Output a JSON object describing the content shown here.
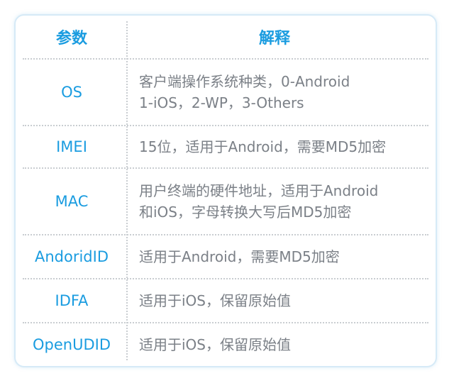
{
  "header": {
    "param": "参数",
    "desc": "解释"
  },
  "rows": [
    {
      "param": "OS",
      "desc": [
        "客户端操作系统种类，0-Android",
        "1-iOS，2-WP，3-Others"
      ]
    },
    {
      "param": "IMEI",
      "desc": [
        "15位，适用于Android，需要MD5加密"
      ]
    },
    {
      "param": "MAC",
      "desc": [
        "用户终端的硬件地址，适用于Android",
        "和iOS，字母转换大写后MD5加密"
      ]
    },
    {
      "param": "AndoridID",
      "desc": [
        "适用于Android，需要MD5加密"
      ]
    },
    {
      "param": "IDFA",
      "desc": [
        "适用于iOS，保留原始值"
      ]
    },
    {
      "param": "OpenUDID",
      "desc": [
        "适用于iOS，保留原始值"
      ]
    }
  ],
  "colors": {
    "accent": "#1a9ce0",
    "text": "#7b8087",
    "border": "#d6eaf7"
  }
}
